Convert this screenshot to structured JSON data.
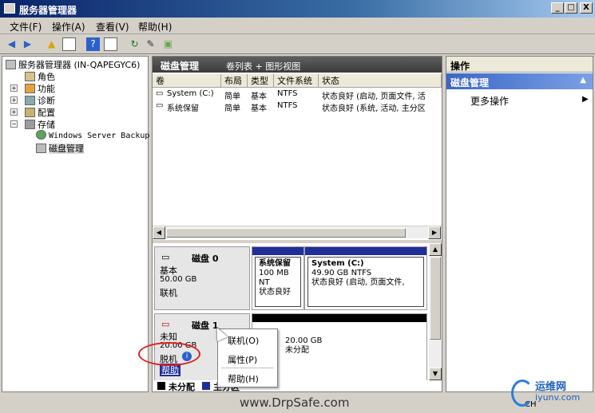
{
  "window": {
    "title": "服务器管理器",
    "min": "_",
    "max": "□",
    "close": "X"
  },
  "menu": [
    "文件(F)",
    "操作(A)",
    "查看(V)",
    "帮助(H)"
  ],
  "tree": {
    "root": "服务器管理器 (IN-QAPEGYC6)",
    "items": [
      "角色",
      "功能",
      "诊断",
      "配置",
      "存储",
      "Windows Server Backup",
      "磁盘管理"
    ]
  },
  "center": {
    "title": "磁盘管理",
    "subtitle": "卷列表 + 图形视图",
    "columns": [
      "卷",
      "布局",
      "类型",
      "文件系统",
      "状态"
    ],
    "rows": [
      [
        "System (C:)",
        "简单",
        "基本",
        "NTFS",
        "状态良好 (启动, 页面文件, 活"
      ],
      [
        "系统保留",
        "简单",
        "基本",
        "NTFS",
        "状态良好 (系统, 活动, 主分区"
      ]
    ]
  },
  "disk0": {
    "name": "磁盘 0",
    "type": "基本",
    "size": "50.00 GB",
    "status": "联机",
    "partitions": [
      {
        "name": "系统保留",
        "size": "100 MB NT",
        "status": "状态良好"
      },
      {
        "name": "System  (C:)",
        "size": "49.90 GB NTFS",
        "status": "状态良好 (启动, 页面文件,"
      }
    ]
  },
  "disk1": {
    "name": "磁盘 1",
    "type": "未知",
    "size": "20.00 GB",
    "status": "脱机",
    "help": "帮助",
    "part_size": "20.00 GB",
    "part_status": "未分配"
  },
  "legend": {
    "unallocated": "未分配",
    "primary": "主分区"
  },
  "context_menu": [
    "联机(O)",
    "属性(P)",
    "帮助(H)"
  ],
  "ops": {
    "header": "操作",
    "section": "磁盘管理",
    "more": "更多操作"
  },
  "watermark": "www.DrpSafe.com",
  "brand": {
    "name": "运维网",
    "url": "iyunv.com"
  },
  "tray": "CH"
}
